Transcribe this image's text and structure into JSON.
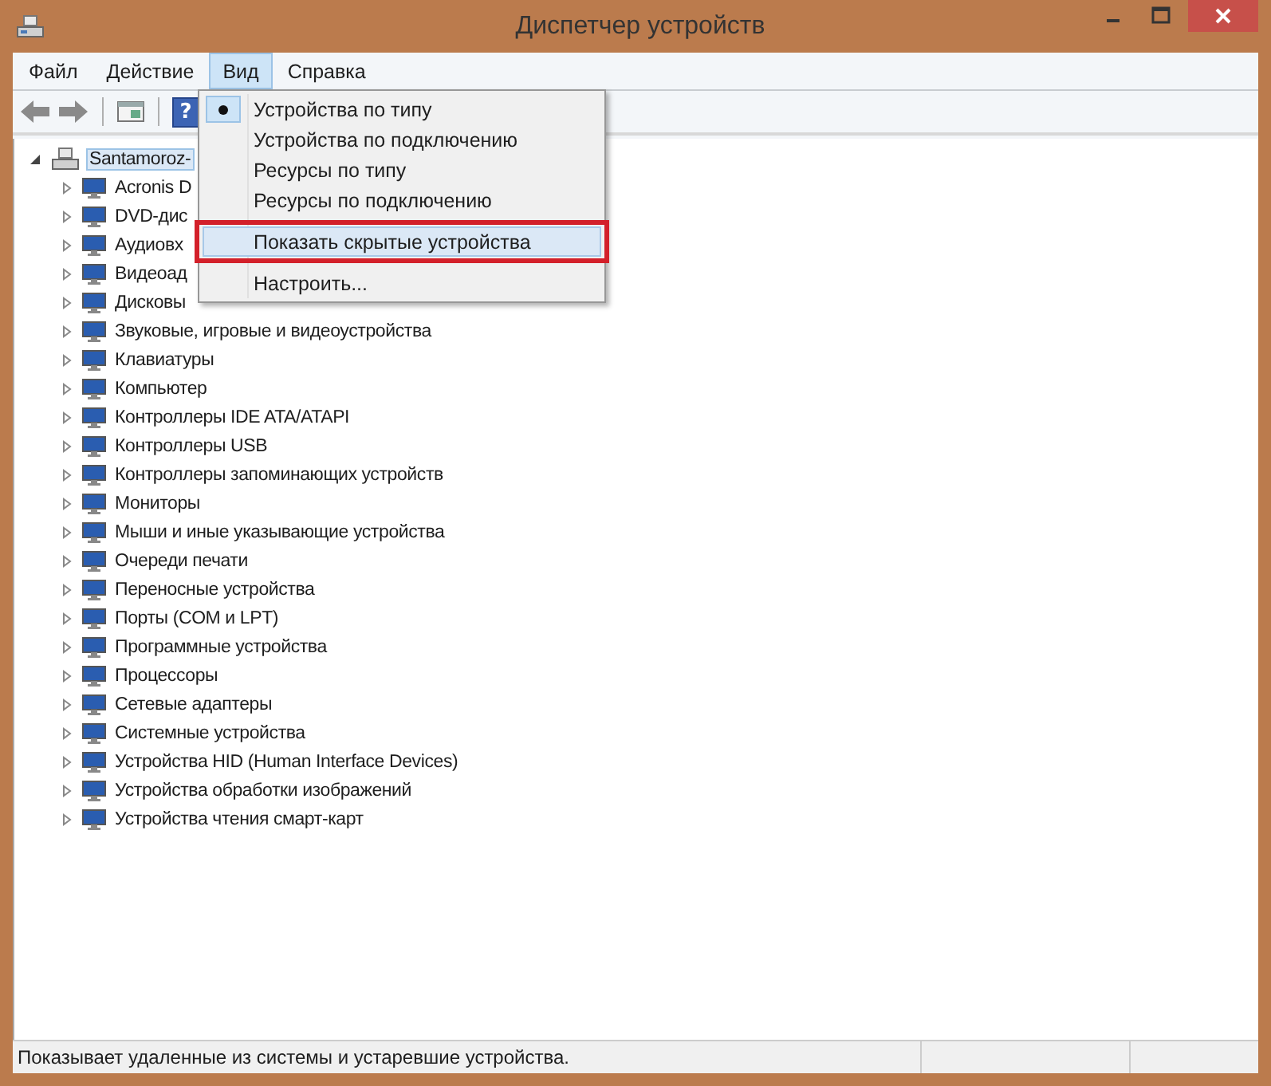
{
  "window": {
    "title": "Диспетчер устройств"
  },
  "menubar": [
    {
      "label": "Файл",
      "selected": false
    },
    {
      "label": "Действие",
      "selected": false
    },
    {
      "label": "Вид",
      "selected": true
    },
    {
      "label": "Справка",
      "selected": false
    }
  ],
  "toolbar": {
    "help_glyph": "?"
  },
  "tree": {
    "root": {
      "label": "Santamoroz-",
      "expanded": true,
      "selected": true,
      "children": [
        {
          "label": "Acronis D",
          "selected": false
        },
        {
          "label": "DVD-дис",
          "selected": false
        },
        {
          "label": "Аудиовх",
          "selected": false
        },
        {
          "label": "Видеоад",
          "selected": false
        },
        {
          "label": "Дисковы",
          "selected": false
        },
        {
          "label": "Звуковые, игровые и видеоустройства",
          "selected": false
        },
        {
          "label": "Клавиатуры",
          "selected": false
        },
        {
          "label": "Компьютер",
          "selected": false
        },
        {
          "label": "Контроллеры IDE ATA/ATAPI",
          "selected": false
        },
        {
          "label": "Контроллеры USB",
          "selected": false
        },
        {
          "label": "Контроллеры запоминающих устройств",
          "selected": false
        },
        {
          "label": "Мониторы",
          "selected": false
        },
        {
          "label": "Мыши и иные указывающие устройства",
          "selected": false
        },
        {
          "label": "Очереди печати",
          "selected": false
        },
        {
          "label": "Переносные устройства",
          "selected": false
        },
        {
          "label": "Порты (COM и LPT)",
          "selected": false
        },
        {
          "label": "Программные устройства",
          "selected": false
        },
        {
          "label": "Процессоры",
          "selected": false
        },
        {
          "label": "Сетевые адаптеры",
          "selected": false
        },
        {
          "label": "Системные устройства",
          "selected": false
        },
        {
          "label": "Устройства HID (Human Interface Devices)",
          "selected": false
        },
        {
          "label": "Устройства обработки изображений",
          "selected": false
        },
        {
          "label": "Устройства чтения смарт-карт",
          "selected": false
        }
      ]
    }
  },
  "view_menu": {
    "items": [
      {
        "kind": "radio",
        "label": "Устройства по типу",
        "checked": true,
        "selected": false,
        "marked": false
      },
      {
        "kind": "radio",
        "label": "Устройства по подключению",
        "checked": false,
        "selected": false,
        "marked": false
      },
      {
        "kind": "radio",
        "label": "Ресурсы по типу",
        "checked": false,
        "selected": false,
        "marked": false
      },
      {
        "kind": "radio",
        "label": "Ресурсы по подключению",
        "checked": false,
        "selected": false,
        "marked": false
      },
      {
        "kind": "separator"
      },
      {
        "kind": "item",
        "label": "Показать скрытые устройства",
        "selected": true,
        "marked": true
      },
      {
        "kind": "separator"
      },
      {
        "kind": "item",
        "label": "Настроить...",
        "selected": false,
        "marked": false
      }
    ]
  },
  "status_bar": {
    "text": "Показывает удаленные из системы и устаревшие устройства."
  }
}
